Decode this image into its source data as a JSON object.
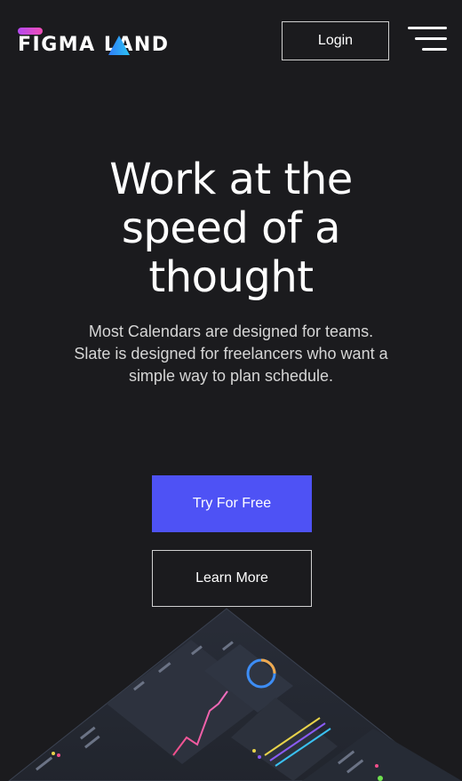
{
  "header": {
    "logo": {
      "text": "FIGMA LAND",
      "icon": "triangle-logo-mark",
      "bar_gradient": [
        "#b449f0",
        "#f04eb6"
      ],
      "triangle_gradient": [
        "#2f7cf6",
        "#2dc3f4"
      ]
    },
    "login_label": "Login",
    "menu_icon": "hamburger-menu-icon"
  },
  "hero": {
    "title_lines": [
      "Work at the",
      "speed of a",
      "thought"
    ],
    "subtitle_lines": [
      "Most Calendars are designed for teams.",
      "Slate is designed for freelancers who want a",
      "simple way to plan schedule."
    ],
    "primary_cta": "Try For Free",
    "secondary_cta": "Learn More"
  },
  "colors": {
    "background": "#1b1b1e",
    "primary": "#4e52f5",
    "text": "#ffffff",
    "muted_text": "#d6d6d6"
  }
}
